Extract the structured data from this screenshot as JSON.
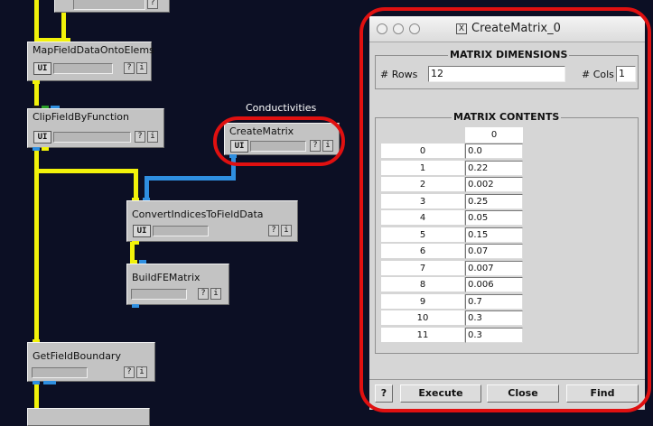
{
  "network": {
    "modules": [
      {
        "title": "MapFieldDataOntoElems",
        "ui": "UI",
        "help": "?",
        "info": "i"
      },
      {
        "title": "ClipFieldByFunction",
        "ui": "UI",
        "help": "?",
        "info": "i"
      },
      {
        "title": "CreateMatrix",
        "ui": "UI",
        "help": "?",
        "info": "i",
        "note": "Conductivities"
      },
      {
        "title": "ConvertIndicesToFieldData",
        "ui": "UI",
        "help": "?",
        "info": "i"
      },
      {
        "title": "BuildFEMatrix",
        "help": "?",
        "info": "i"
      },
      {
        "title": "GetFieldBoundary",
        "help": "?",
        "info": "i"
      }
    ]
  },
  "dialog": {
    "title": "CreateMatrix_0",
    "dimensions": {
      "title": "MATRIX DIMENSIONS",
      "rows_label": "# Rows",
      "rows_value": "12",
      "cols_label": "# Cols",
      "cols_value": "1"
    },
    "contents": {
      "title": "MATRIX CONTENTS",
      "column_header": "0",
      "rows": [
        {
          "index": "0",
          "value": "0.0"
        },
        {
          "index": "1",
          "value": "0.22"
        },
        {
          "index": "2",
          "value": "0.002"
        },
        {
          "index": "3",
          "value": "0.25"
        },
        {
          "index": "4",
          "value": "0.05"
        },
        {
          "index": "5",
          "value": "0.15"
        },
        {
          "index": "6",
          "value": "0.07"
        },
        {
          "index": "7",
          "value": "0.007"
        },
        {
          "index": "8",
          "value": "0.006"
        },
        {
          "index": "9",
          "value": "0.7"
        },
        {
          "index": "10",
          "value": "0.3"
        },
        {
          "index": "11",
          "value": "0.3"
        }
      ]
    },
    "buttons": {
      "help": "?",
      "execute": "Execute",
      "close": "Close",
      "find": "Find"
    }
  },
  "colors": {
    "background": "#0c0f24",
    "wire_data": "#f2f20a",
    "wire_matrix": "#2f8fe0",
    "highlight": "#e01010"
  }
}
